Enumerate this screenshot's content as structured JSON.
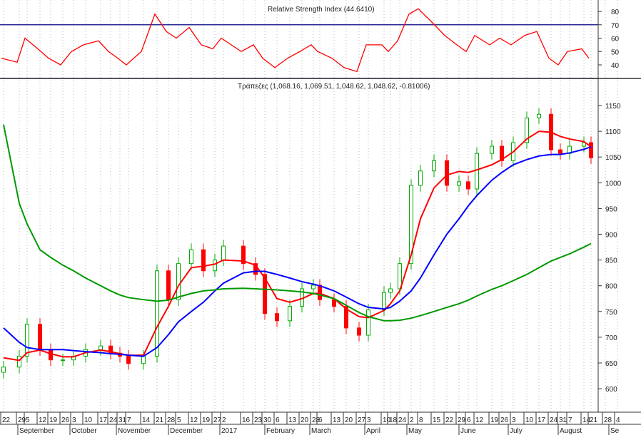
{
  "chart_data": [
    {
      "type": "line",
      "title": "Relative Strength Index (44.6410)",
      "ylim": [
        30,
        85
      ],
      "yticks": [
        40,
        50,
        60,
        70,
        80
      ],
      "reference_lines": [
        70,
        30
      ],
      "series": [
        {
          "name": "RSI",
          "color": "#ff0000",
          "values": [
            45,
            42,
            60,
            52,
            45,
            40,
            50,
            55,
            58,
            50,
            45,
            40,
            50,
            78,
            65,
            60,
            68,
            55,
            52,
            60,
            50,
            55,
            45,
            38,
            45,
            50,
            55,
            50,
            45,
            38,
            35,
            55,
            55,
            50,
            58,
            78,
            82,
            72,
            62,
            55,
            50,
            62,
            55,
            60,
            55,
            62,
            65,
            45,
            40,
            50,
            52,
            45
          ]
        }
      ]
    },
    {
      "type": "candlestick",
      "title": "Τράπεζες (1,068.16, 1,069.51, 1,048.62, 1,048.62, -0.81006)",
      "ylim": [
        560,
        1180
      ],
      "yticks": [
        600,
        650,
        700,
        750,
        800,
        850,
        900,
        950,
        1000,
        1050,
        1100,
        1150
      ],
      "grid": true,
      "close": [
        642,
        663,
        725,
        676,
        656,
        656,
        663,
        676,
        683,
        669,
        663,
        649,
        663,
        829,
        773,
        843,
        870,
        829,
        850,
        877,
        843,
        822,
        746,
        732,
        760,
        794,
        801,
        773,
        760,
        718,
        704,
        753,
        787,
        794,
        843,
        995,
        1023,
        1043,
        995,
        1002,
        988,
        1057,
        1071,
        1043,
        1078,
        1126,
        1133,
        1064,
        1057,
        1071,
        1078,
        1048.62
      ],
      "series": [
        {
          "name": "MA20",
          "color": "#ff0000",
          "values": [
            660,
            655,
            670,
            675,
            668,
            662,
            662,
            670,
            675,
            672,
            668,
            665,
            665,
            720,
            760,
            800,
            835,
            838,
            842,
            850,
            848,
            840,
            815,
            775,
            768,
            775,
            785,
            785,
            775,
            755,
            740,
            738,
            752,
            765,
            790,
            860,
            930,
            990,
            1015,
            1022,
            1020,
            1025,
            1035,
            1045,
            1060,
            1085,
            1100,
            1098,
            1090,
            1085,
            1080,
            1070
          ]
        },
        {
          "name": "MA50",
          "color": "#0000ff",
          "values": [
            718,
            690,
            680,
            676,
            676,
            676,
            674,
            672,
            670,
            668,
            667,
            665,
            663,
            680,
            705,
            730,
            750,
            768,
            790,
            805,
            825,
            828,
            828,
            822,
            815,
            808,
            803,
            800,
            790,
            778,
            765,
            758,
            755,
            758,
            770,
            790,
            815,
            860,
            900,
            930,
            955,
            975,
            1005,
            1020,
            1035,
            1045,
            1052,
            1055,
            1055,
            1058,
            1065,
            1070
          ]
        },
        {
          "name": "MA200",
          "color": "#009900",
          "values": [
            1113,
            960,
            920,
            870,
            855,
            840,
            829,
            815,
            800,
            790,
            782,
            777,
            773,
            770,
            772,
            778,
            785,
            790,
            792,
            794,
            795,
            794,
            793,
            792,
            790,
            788,
            785,
            782,
            775,
            762,
            748,
            740,
            732,
            732,
            733,
            737,
            742,
            750,
            758,
            765,
            772,
            780,
            793,
            800,
            810,
            822,
            835,
            848,
            855,
            862,
            875,
            882
          ]
        }
      ]
    }
  ],
  "x_axis": {
    "day_ticks": [
      "22",
      "29",
      "5",
      "12",
      "19",
      "26",
      "3",
      "10",
      "17",
      "24",
      "31",
      "7",
      "14",
      "21",
      "28",
      "5",
      "12",
      "19",
      "27",
      "2",
      "16",
      "23",
      "30",
      "6",
      "13",
      "20",
      "28",
      "6",
      "13",
      "20",
      "27",
      "3",
      "10",
      "18",
      "24",
      "2",
      "8",
      "15",
      "22",
      "29",
      "6",
      "12",
      "19",
      "26",
      "3",
      "10",
      "17",
      "24",
      "31",
      "7",
      "14",
      "21",
      "28",
      "4"
    ],
    "months": [
      "September",
      "October",
      "November",
      "December",
      "2017",
      "February",
      "March",
      "April",
      "May",
      "June",
      "July",
      "August",
      "Se"
    ]
  },
  "colors": {
    "rsi_ref": "#000080",
    "up": "#00aa00",
    "down": "#ff0000",
    "grid": "#bbbbbb"
  }
}
